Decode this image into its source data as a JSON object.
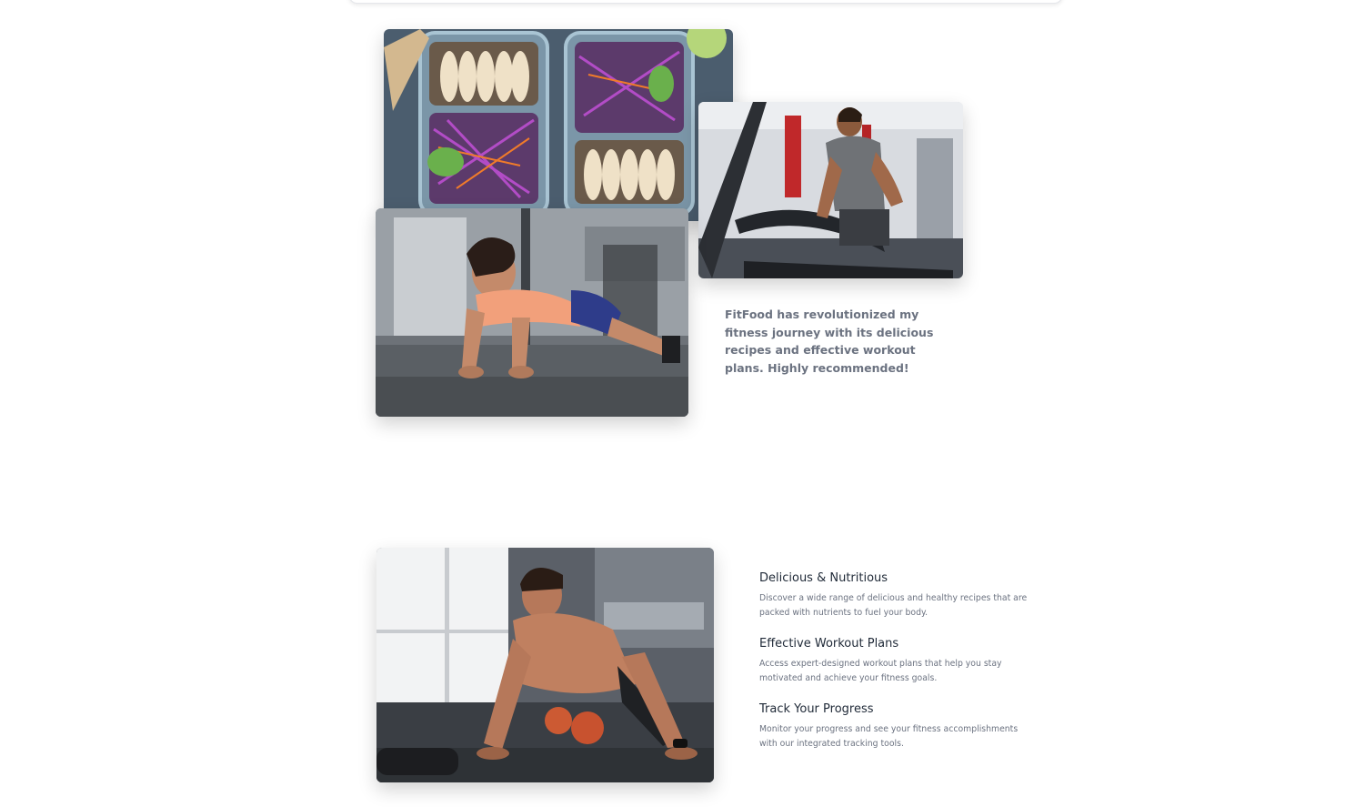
{
  "testimonial": {
    "text": "FitFood has revolutionized my fitness journey with its delicious recipes and effective workout plans. Highly recommended!"
  },
  "images": {
    "meal_prep": "meal-prep-photo",
    "treadmill": "treadmill-runner-photo",
    "plank": "woman-plank-photo",
    "pushup": "man-pushup-photo"
  },
  "features": [
    {
      "title": "Delicious & Nutritious",
      "description": "Discover a wide range of delicious and healthy recipes that are packed with nutrients to fuel your body."
    },
    {
      "title": "Effective Workout Plans",
      "description": "Access expert-designed workout plans that help you stay motivated and achieve your fitness goals."
    },
    {
      "title": "Track Your Progress",
      "description": "Monitor your progress and see your fitness accomplishments with our integrated tracking tools."
    }
  ]
}
